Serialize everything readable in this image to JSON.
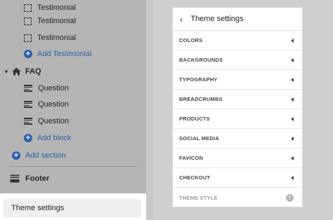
{
  "sidebar": {
    "testimonials": [
      {
        "label": "Testimonial",
        "icon": "dashed-block-icon"
      },
      {
        "label": "Testimonial",
        "icon": "dashed-block-icon"
      },
      {
        "label": "Testimonial",
        "icon": "dashed-block-icon"
      }
    ],
    "add_testimonial": "Add Testimonial",
    "faq_label": "FAQ",
    "questions": [
      {
        "label": "Question"
      },
      {
        "label": "Question"
      },
      {
        "label": "Question"
      }
    ],
    "add_block": "Add block",
    "add_section": "Add section",
    "footer_label": "Footer",
    "theme_settings": "Theme settings"
  },
  "panel": {
    "title": "Theme settings",
    "back_icon": "chevron-left-icon",
    "items": [
      {
        "label": "COLORS"
      },
      {
        "label": "BACKGROUNDS"
      },
      {
        "label": "TYPOGRAPHY"
      },
      {
        "label": "BREADCRUMBS"
      },
      {
        "label": "PRODUCTS"
      },
      {
        "label": "SOCIAL MEDIA"
      },
      {
        "label": "FAVICON"
      },
      {
        "label": "CHECKOUT"
      }
    ],
    "theme_style": "THEME STYLE",
    "info_glyph": "!"
  },
  "colors": {
    "accent": "#2d5fb1",
    "sidebar_bg": "#b5b5b5",
    "panel_bg": "#ffffff"
  }
}
